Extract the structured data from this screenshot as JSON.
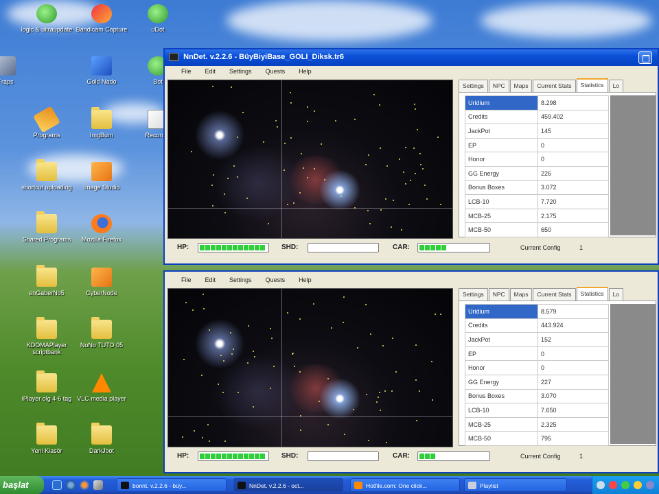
{
  "desktop": {
    "icons": [
      {
        "label": "logic & ultraupdate",
        "icon": "app-green-icon"
      },
      {
        "label": "Bandicam Capture",
        "icon": "app-red-icon"
      },
      {
        "label": "uDot",
        "icon": "app-green-icon"
      },
      {
        "label": "Fraps",
        "icon": "app-grey-icon"
      },
      {
        "label": "Gold Nado",
        "icon": "app-blue-icon"
      },
      {
        "label": "Bot",
        "icon": "app-green-icon"
      },
      {
        "label": "Programs",
        "icon": "pencil-icon"
      },
      {
        "label": "ImgBurn",
        "icon": "folder-icon"
      },
      {
        "label": "Recorder",
        "icon": "recorder-icon"
      },
      {
        "label": "shortcut uploading",
        "icon": "folder-icon"
      },
      {
        "label": "Image Studio",
        "icon": "app-orange-icon"
      },
      {
        "label": "Shared Programs",
        "icon": "folder-icon"
      },
      {
        "label": "Mozilla Firefox",
        "icon": "firefox-icon"
      },
      {
        "label": "enGaberNo5",
        "icon": "folder-icon"
      },
      {
        "label": "CyberNode",
        "icon": "app-orange-icon"
      },
      {
        "label": "KDOMAPlayer scriptbank",
        "icon": "folder-icon"
      },
      {
        "label": "NoNo TUTO 05",
        "icon": "folder-icon"
      },
      {
        "label": "iPlayer olg 4-6 tag",
        "icon": "folder-icon"
      },
      {
        "label": "VLC media player",
        "icon": "vlc-icon"
      },
      {
        "label": "Yeni Klasör",
        "icon": "folder-icon"
      },
      {
        "label": "DarkJbot",
        "icon": "folder-icon"
      }
    ]
  },
  "window1": {
    "title": "NnDet. v.2.2.6 - BüyBiyiBase_GOLI_Diksk.tr6",
    "menu": [
      "File",
      "Edit",
      "Settings",
      "Quests",
      "Help"
    ],
    "tabs": [
      "Settings",
      "NPC",
      "Maps",
      "Current Stats",
      "Statistics",
      "Lo"
    ],
    "active_tab": "Statistics",
    "stats": [
      {
        "k": "Uridium",
        "v": "8.298"
      },
      {
        "k": "Credits",
        "v": "459.402"
      },
      {
        "k": "JackPot",
        "v": "145"
      },
      {
        "k": "EP",
        "v": "0"
      },
      {
        "k": "Honor",
        "v": "0"
      },
      {
        "k": "GG Energy",
        "v": "226"
      },
      {
        "k": "Bonus Boxes",
        "v": "3.072"
      },
      {
        "k": "LCB-10",
        "v": "7.720"
      },
      {
        "k": "MCB-25",
        "v": "2.175"
      },
      {
        "k": "MCB-50",
        "v": "650"
      }
    ],
    "status": {
      "hp": "HP:",
      "shd": "SHD:",
      "car": "CAR:",
      "config_label": "Current Config",
      "config_value": "1"
    },
    "hp_fill": 1.0,
    "shd_fill": 0.0,
    "car_fill": 0.45
  },
  "window2": {
    "menu": [
      "File",
      "Edit",
      "Settings",
      "Quests",
      "Help"
    ],
    "tabs": [
      "Settings",
      "NPC",
      "Maps",
      "Current Stats",
      "Statistics",
      "Lo"
    ],
    "active_tab": "Statistics",
    "stats": [
      {
        "k": "Uridium",
        "v": "8.579"
      },
      {
        "k": "Credits",
        "v": "443.924"
      },
      {
        "k": "JackPot",
        "v": "152"
      },
      {
        "k": "EP",
        "v": "0"
      },
      {
        "k": "Honor",
        "v": "0"
      },
      {
        "k": "GG Energy",
        "v": "227"
      },
      {
        "k": "Bonus Boxes",
        "v": "3.070"
      },
      {
        "k": "LCB-10",
        "v": "7.650"
      },
      {
        "k": "MCB-25",
        "v": "2.325"
      },
      {
        "k": "MCB-50",
        "v": "795"
      }
    ],
    "status": {
      "hp": "HP:",
      "shd": "SHD:",
      "car": "CAR:",
      "config_label": "Current Config",
      "config_value": "1"
    },
    "hp_fill": 1.0,
    "shd_fill": 0.0,
    "car_fill": 0.25
  },
  "taskbar": {
    "start": "başlat",
    "tasks": [
      {
        "label": "bonnt. v.2.2.6 - büy...",
        "icon": "bot-icon"
      },
      {
        "label": "NnDet. v.2.2.6 - oct...",
        "icon": "bot-icon"
      },
      {
        "label": "Hotfile.com: One click...",
        "icon": "firefox-icon"
      },
      {
        "label": "Playlist",
        "icon": "player-icon"
      }
    ]
  }
}
